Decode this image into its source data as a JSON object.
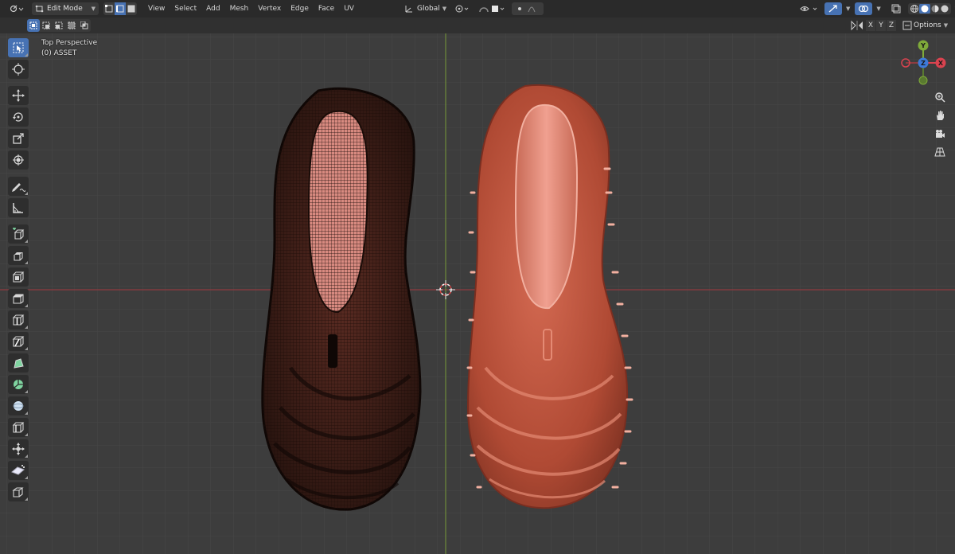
{
  "header": {
    "editor_type_icon": "3d-viewport-icon",
    "mode": "Edit Mode",
    "menus": [
      "View",
      "Select",
      "Add",
      "Mesh",
      "Vertex",
      "Edge",
      "Face",
      "UV"
    ],
    "transform_orientation": "Global",
    "options_label": "Options",
    "axis_x": "X",
    "axis_y": "Y",
    "axis_z": "Z"
  },
  "viewport": {
    "view_name": "Top Perspective",
    "object_name": "(0) ASSET"
  },
  "gizmo": {
    "y_label": "Y",
    "z_label": "Z",
    "x_label": "X"
  },
  "colors": {
    "header_bg": "#2a2a2a",
    "viewport_bg": "#3d3d3d",
    "accent": "#4772b3",
    "axis_x": "#d9434f",
    "axis_y": "#7faa3a",
    "axis_z": "#3d7ad9",
    "mesh_dark": "#2a1410",
    "mesh_shaded": "#c0503a"
  },
  "tools": [
    {
      "name": "select-box",
      "icon": "cursor-select-icon",
      "active": true
    },
    {
      "name": "cursor",
      "icon": "3d-cursor-icon"
    },
    {
      "name": "move",
      "icon": "move-icon"
    },
    {
      "name": "rotate",
      "icon": "rotate-icon"
    },
    {
      "name": "scale",
      "icon": "scale-icon"
    },
    {
      "name": "transform",
      "icon": "transform-icon"
    },
    {
      "name": "annotate",
      "icon": "annotate-icon"
    },
    {
      "name": "measure",
      "icon": "measure-icon"
    },
    {
      "name": "add-cube",
      "icon": "add-cube-icon"
    },
    {
      "name": "extrude-region",
      "icon": "extrude-icon"
    },
    {
      "name": "inset-faces",
      "icon": "inset-icon"
    },
    {
      "name": "bevel",
      "icon": "bevel-icon"
    },
    {
      "name": "loop-cut",
      "icon": "loop-cut-icon"
    },
    {
      "name": "knife",
      "icon": "knife-icon"
    },
    {
      "name": "poly-build",
      "icon": "poly-build-icon"
    },
    {
      "name": "spin",
      "icon": "spin-icon"
    },
    {
      "name": "smooth",
      "icon": "smooth-icon"
    },
    {
      "name": "edge-slide",
      "icon": "edge-slide-icon"
    },
    {
      "name": "shrink-fatten",
      "icon": "shrink-fatten-icon"
    },
    {
      "name": "shear",
      "icon": "shear-icon"
    },
    {
      "name": "rip-region",
      "icon": "rip-icon"
    }
  ]
}
